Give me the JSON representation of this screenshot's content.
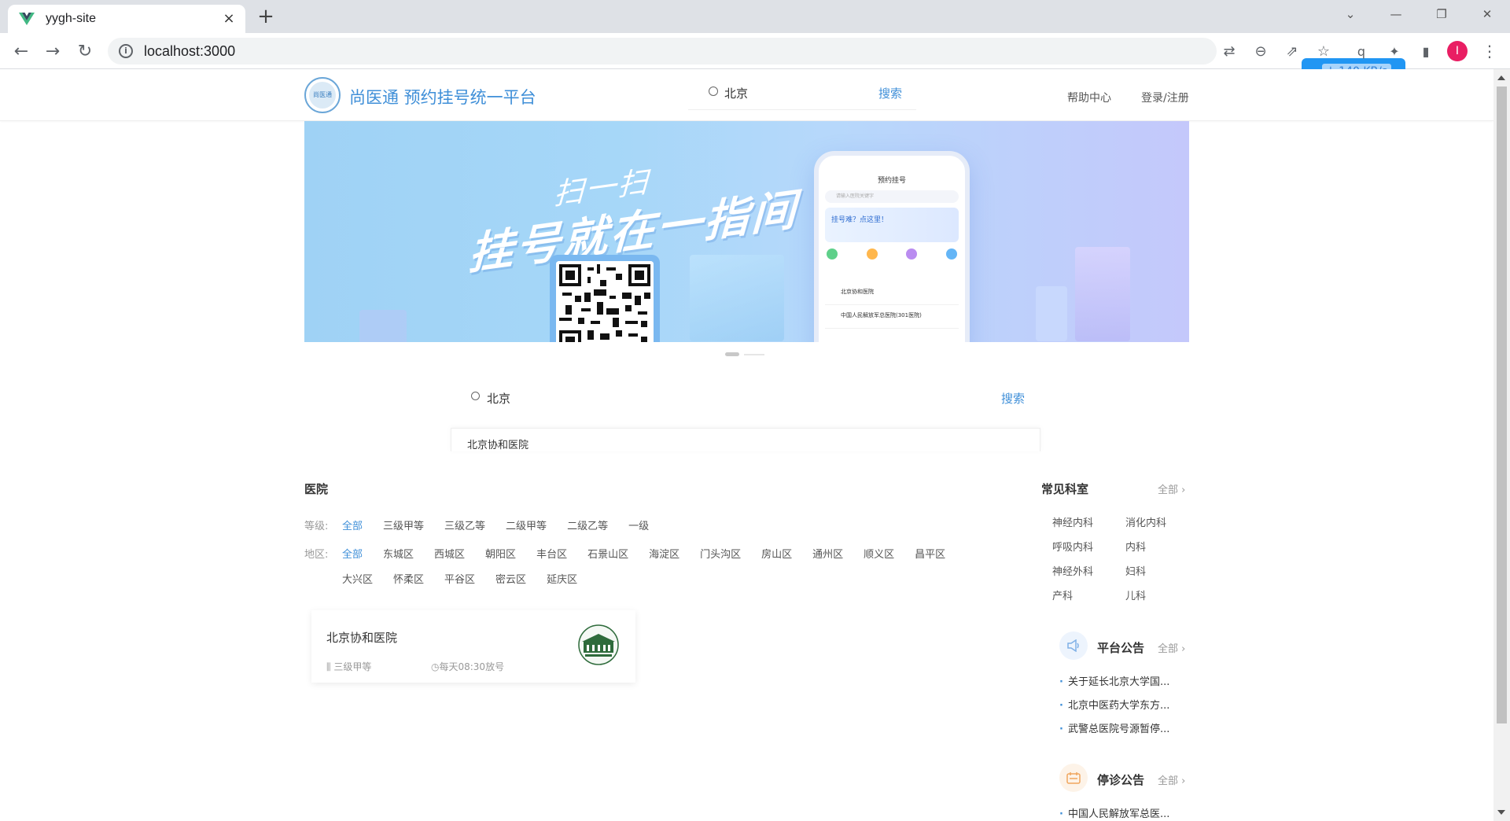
{
  "browser": {
    "tab_title": "yygh-site",
    "url": "localhost:3000",
    "speed": "↓ 140 KB/s",
    "profile_initial": "I",
    "notif_count": "1"
  },
  "header": {
    "logo_text": "尚医通",
    "title": "尚医通 预约挂号统一平台",
    "search_value": "北京",
    "search_button": "搜索",
    "help": "帮助中心",
    "login": "登录/注册"
  },
  "banner": {
    "slogan_small": "扫一扫",
    "slogan_big": "挂号就在一指间",
    "phone_title": "预约挂号",
    "phone_search_placeholder": "请输入医院关键字",
    "phone_card": "挂号难？点这里！",
    "phone_list": [
      "北京协和医院",
      "中国人民解放军总医院(301医院)"
    ]
  },
  "main_search": {
    "value": "北京",
    "button": "搜索",
    "suggestion": "北京协和医院"
  },
  "hospitals": {
    "heading": "医院",
    "level_label": "等级:",
    "levels": [
      "全部",
      "三级甲等",
      "三级乙等",
      "二级甲等",
      "二级乙等",
      "一级"
    ],
    "region_label": "地区:",
    "regions": [
      "全部",
      "东城区",
      "西城区",
      "朝阳区",
      "丰台区",
      "石景山区",
      "海淀区",
      "门头沟区",
      "房山区",
      "通州区",
      "顺义区",
      "昌平区",
      "大兴区",
      "怀柔区",
      "平谷区",
      "密云区",
      "延庆区"
    ],
    "card": {
      "name": "北京协和医院",
      "level": "三级甲等",
      "time": "每天08:30放号"
    }
  },
  "sidebar": {
    "departments_heading": "常见科室",
    "all": "全部",
    "departments": [
      "神经内科",
      "消化内科",
      "呼吸内科",
      "内科",
      "神经外科",
      "妇科",
      "产科",
      "儿科"
    ],
    "platform_notice_heading": "平台公告",
    "platform_notices": [
      "关于延长北京大学国...",
      "北京中医药大学东方...",
      "武警总医院号源暂停..."
    ],
    "suspension_notice_heading": "停诊公告",
    "suspension_notices": [
      "中国人民解放军总医..."
    ]
  },
  "colors": {
    "accent": "#3f8fd8",
    "banner_start": "#9fd2f5",
    "banner_end": "#c4c8fb"
  }
}
